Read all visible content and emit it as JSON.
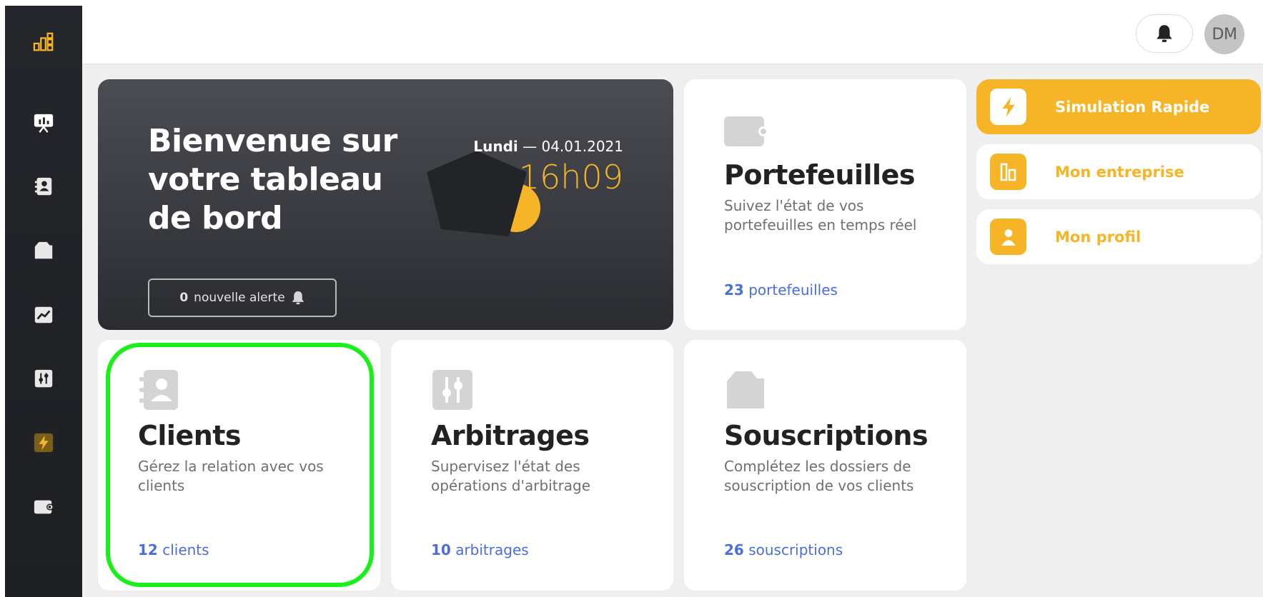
{
  "user": {
    "initials": "DM"
  },
  "hero": {
    "title": "Bienvenue sur votre tableau de bord",
    "day": "Lundi",
    "date_sep": " — ",
    "date": "04.01.2021",
    "time": "16h09",
    "alert_count": "0",
    "alert_label": "nouvelle alerte"
  },
  "cards": {
    "portefeuilles": {
      "title": "Portefeuilles",
      "desc": "Suivez l'état de vos portefeuilles en temps réel",
      "count": "23",
      "unit": "portefeuilles"
    },
    "clients": {
      "title": "Clients",
      "desc": "Gérez la relation avec vos clients",
      "count": "12",
      "unit": "clients"
    },
    "arbitrages": {
      "title": "Arbitrages",
      "desc": "Supervisez l'état des opérations d'arbitrage",
      "count": "10",
      "unit": "arbitrages"
    },
    "souscriptions": {
      "title": "Souscriptions",
      "desc": "Complétez les dossiers de souscription de vos clients",
      "count": "26",
      "unit": "souscriptions"
    }
  },
  "quick_actions": [
    {
      "label": "Simulation Rapide",
      "icon": "lightning-icon"
    },
    {
      "label": "Mon entreprise",
      "icon": "building-icon"
    },
    {
      "label": "Mon profil",
      "icon": "user-icon"
    }
  ],
  "sidebar": {
    "items": [
      {
        "icon": "logo-icon"
      },
      {
        "icon": "presentation-icon"
      },
      {
        "icon": "contacts-icon"
      },
      {
        "icon": "folder-icon"
      },
      {
        "icon": "chart-icon"
      },
      {
        "icon": "sliders-icon"
      },
      {
        "icon": "lightning-icon"
      },
      {
        "icon": "wallet-icon"
      }
    ]
  },
  "colors": {
    "accent": "#f6b526",
    "link": "#4a6fd8",
    "highlight": "#19f019",
    "sidebar": "#202226"
  }
}
